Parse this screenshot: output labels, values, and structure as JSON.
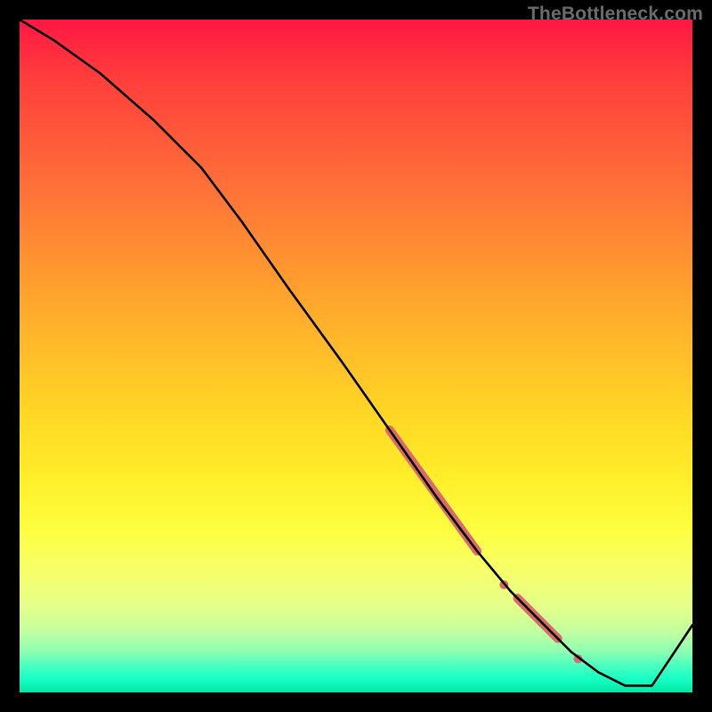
{
  "watermark": "TheBottleneck.com",
  "chart_data": {
    "type": "line",
    "title": "",
    "xlabel": "",
    "ylabel": "",
    "xlim": [
      0,
      100
    ],
    "ylim": [
      0,
      100
    ],
    "grid": false,
    "series": [
      {
        "name": "bottleneck-curve",
        "color": "#000000",
        "width": 2.6,
        "x": [
          0,
          5,
          12,
          20,
          27,
          33,
          40,
          48,
          55,
          62,
          68,
          73,
          78,
          82,
          86,
          90,
          94,
          100
        ],
        "y": [
          100,
          97,
          92,
          85,
          78,
          70,
          60,
          49,
          39,
          29,
          21,
          15,
          10,
          6,
          3,
          1,
          1,
          10
        ]
      }
    ],
    "highlights": [
      {
        "name": "segment-upper",
        "x0": 55,
        "y0": 39,
        "x1": 68,
        "y1": 21,
        "color": "#d96b6b",
        "width": 10
      },
      {
        "name": "dot-mid",
        "cx": 72,
        "cy": 16,
        "r": 5,
        "color": "#d96b6b"
      },
      {
        "name": "segment-lower",
        "x0": 74,
        "y0": 14,
        "x1": 80,
        "y1": 8,
        "color": "#d96b6b",
        "width": 10
      },
      {
        "name": "dot-end",
        "cx": 83,
        "cy": 5,
        "r": 5,
        "color": "#d96b6b"
      }
    ],
    "background": {
      "type": "vertical-gradient",
      "stops": [
        {
          "pos": 0.0,
          "color": "#ff1744"
        },
        {
          "pos": 0.5,
          "color": "#ffd524"
        },
        {
          "pos": 0.8,
          "color": "#feff40"
        },
        {
          "pos": 1.0,
          "color": "#00e7a5"
        }
      ]
    }
  }
}
